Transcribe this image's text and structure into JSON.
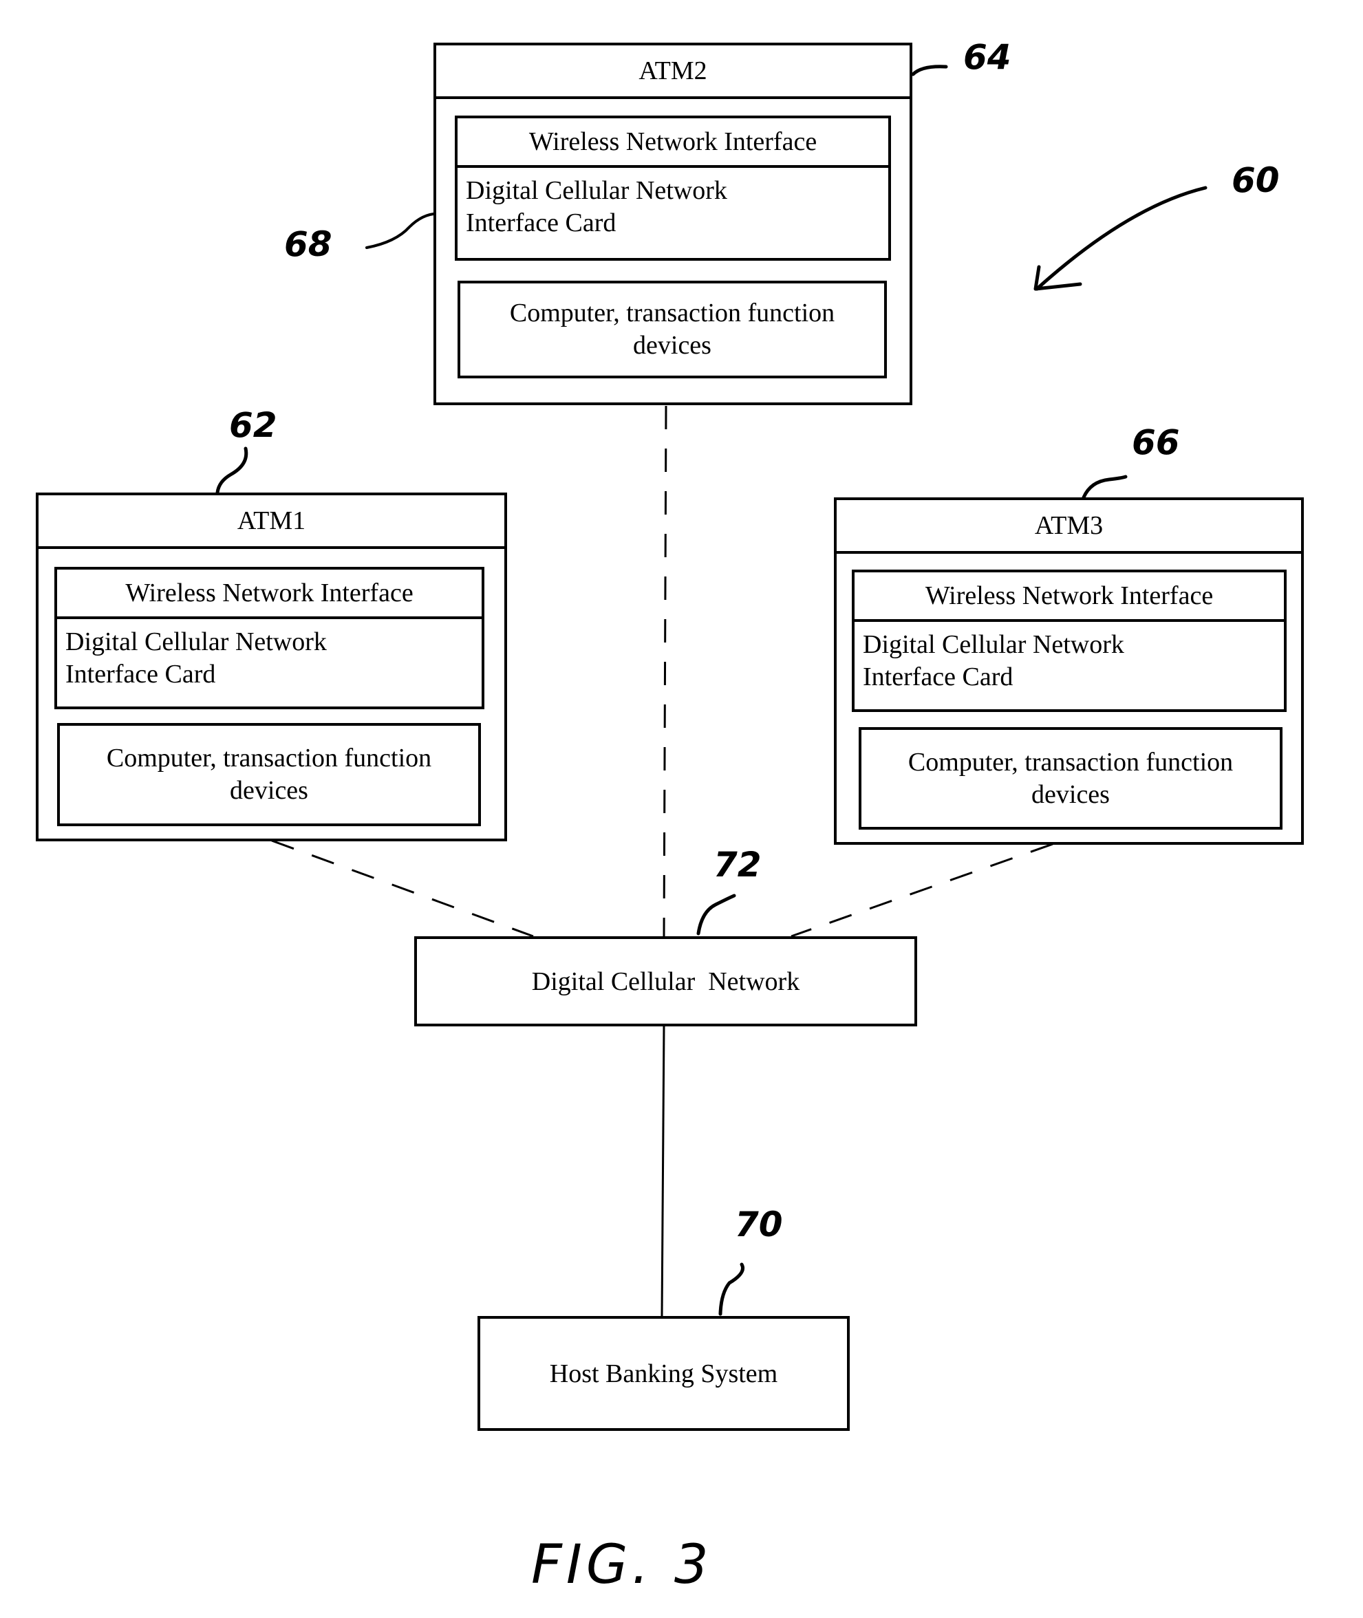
{
  "figure": {
    "label": "FIG. 3",
    "system_ref": "60"
  },
  "atms": [
    {
      "id": "atm1",
      "title": "ATM1",
      "ref": "62",
      "wireless_interface": "Wireless Network Interface",
      "card": "Digital Cellular Network\nInterface Card",
      "computer": "Computer, transaction function\ndevices"
    },
    {
      "id": "atm2",
      "title": "ATM2",
      "ref": "64",
      "card_ref": "68",
      "wireless_interface": "Wireless Network Interface",
      "card": "Digital Cellular Network\nInterface Card",
      "computer": "Computer, transaction function\ndevices"
    },
    {
      "id": "atm3",
      "title": "ATM3",
      "ref": "66",
      "wireless_interface": "Wireless Network Interface",
      "card": "Digital Cellular Network\nInterface Card",
      "computer": "Computer, transaction function\ndevices"
    }
  ],
  "network": {
    "label": "Digital Cellular  Network",
    "ref": "72"
  },
  "host": {
    "label": "Host Banking System",
    "ref": "70"
  },
  "connections": [
    {
      "from": "ATM1",
      "to": "Digital Cellular Network",
      "style": "dashed"
    },
    {
      "from": "ATM2",
      "to": "Digital Cellular Network",
      "style": "dashed"
    },
    {
      "from": "ATM3",
      "to": "Digital Cellular Network",
      "style": "dashed"
    },
    {
      "from": "Digital Cellular Network",
      "to": "Host Banking System",
      "style": "solid"
    }
  ]
}
